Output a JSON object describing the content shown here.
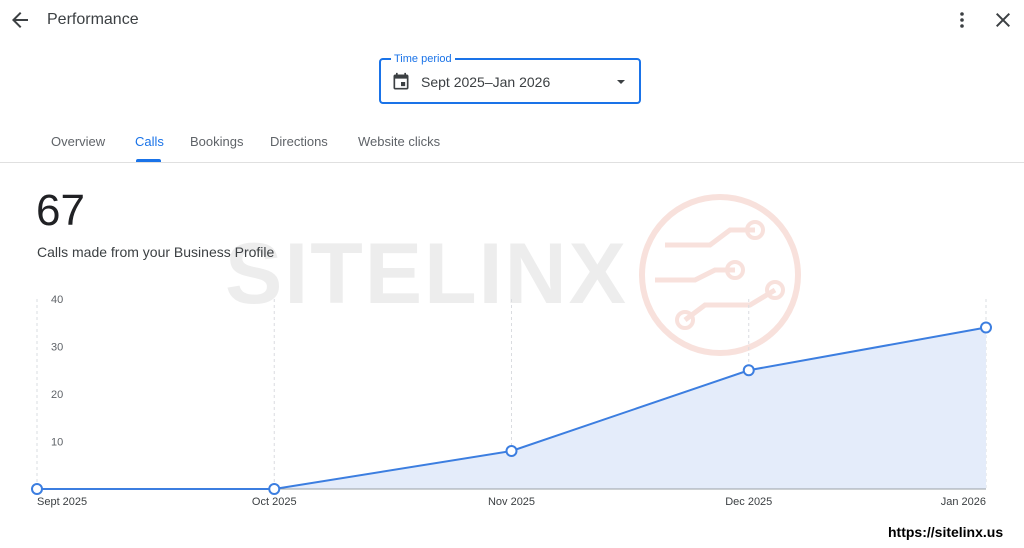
{
  "header": {
    "title": "Performance",
    "back_icon": "arrow-back-icon",
    "more_icon": "more-vert-icon",
    "close_icon": "close-icon"
  },
  "time_period": {
    "label": "Time period",
    "value": "Sept 2025–Jan 2026"
  },
  "tabs": [
    {
      "label": "Overview",
      "active": false
    },
    {
      "label": "Calls",
      "active": true
    },
    {
      "label": "Bookings",
      "active": false
    },
    {
      "label": "Directions",
      "active": false
    },
    {
      "label": "Website clicks",
      "active": false
    }
  ],
  "summary": {
    "count": "67",
    "description": "Calls made from your Business Profile"
  },
  "watermark": {
    "text": "SITELINX"
  },
  "footer": {
    "url": "https://sitelinx.us"
  },
  "colors": {
    "accent": "#1a73e8",
    "line": "#3c7ee0",
    "area": "#e4ecfa"
  },
  "chart_data": {
    "type": "area",
    "categories": [
      "Sept 2025",
      "Oct 2025",
      "Nov 2025",
      "Dec 2025",
      "Jan 2026"
    ],
    "values": [
      0,
      0,
      8,
      25,
      34
    ],
    "y_ticks": [
      "10",
      "20",
      "30",
      "40"
    ],
    "ylim": [
      0,
      40
    ],
    "grid": "vertical dashed",
    "markers": "hollow circles"
  }
}
